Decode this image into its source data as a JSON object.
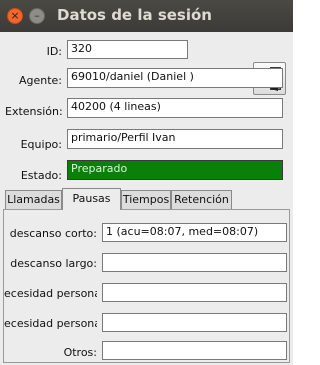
{
  "window": {
    "title": "Datos de la sesión",
    "close_glyph": "×",
    "minimize_glyph": "–"
  },
  "form": {
    "id_label": "ID:",
    "id_value": "320",
    "agent_label": "Agente:",
    "agent_value": "69010/daniel (Daniel )",
    "extension_label": "Extensión:",
    "extension_value": "40200 (4 lineas)",
    "team_label": "Equipo:",
    "team_value": "primario/Perfil Ivan",
    "status_label": "Estado:",
    "status_value": "Preparado"
  },
  "tabs": [
    {
      "label": "Llamadas"
    },
    {
      "label": "Pausas"
    },
    {
      "label": "Tiempos"
    },
    {
      "label": "Retención"
    }
  ],
  "pausas": {
    "rows": [
      {
        "label": "descanso corto:",
        "value": "1 (acu=08:07, med=08:07)"
      },
      {
        "label": "descanso largo:",
        "value": ""
      },
      {
        "label": "ecesidad personal:",
        "value": ""
      },
      {
        "label": "ecesidad personal:",
        "value": ""
      },
      {
        "label": "Otros:",
        "value": ""
      }
    ]
  },
  "colors": {
    "status_green": "#0a7f0a",
    "titlebar": "#3c3b37",
    "exit_arrow": "#e0312b"
  },
  "icons": {
    "exit": "exit-door-icon"
  }
}
